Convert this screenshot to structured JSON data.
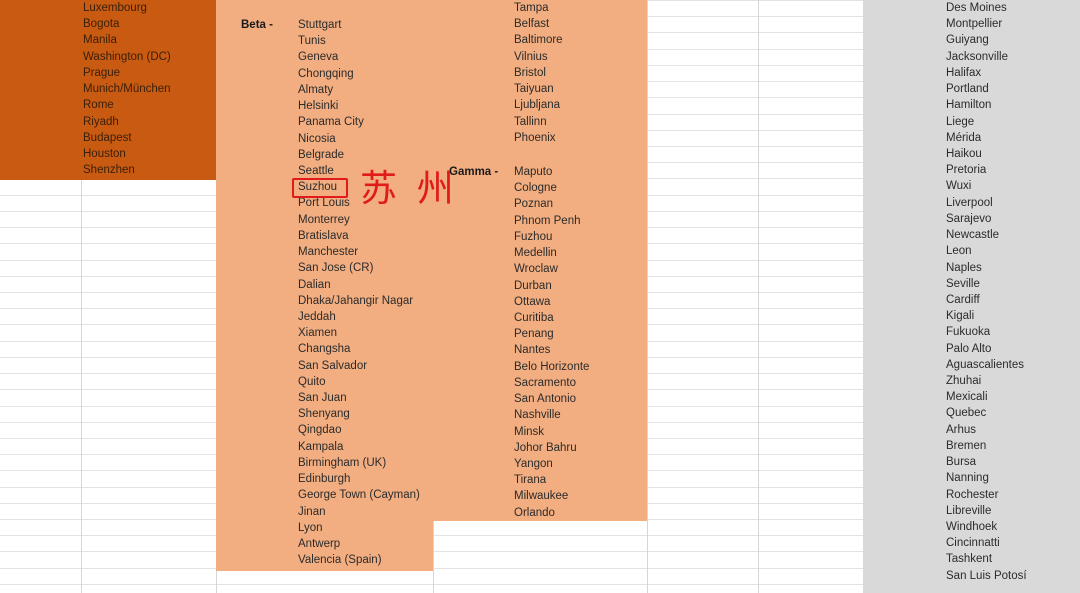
{
  "colors": {
    "alpha_block": "#c85a12",
    "beta_gamma_block": "#f2ae80",
    "right_block": "#d9d9d9",
    "annotation": "#e01b1b",
    "grid_line": "#e3e3e3"
  },
  "tier_labels": {
    "beta": "Beta -",
    "gamma": "Gamma -"
  },
  "annotation": {
    "highlighted_city": "Suzhou",
    "chinese_text": "苏 州"
  },
  "columns": {
    "alpha_tail": [
      "Luxembourg",
      "Bogota",
      "Manila",
      "Washington (DC)",
      "Prague",
      "Munich/München",
      "Rome",
      "Riyadh",
      "Budapest",
      "Houston",
      "Shenzhen"
    ],
    "beta": [
      "Stuttgart",
      "Tunis",
      "Geneva",
      "Chongqing",
      "Almaty",
      "Helsinki",
      "Panama City",
      "Nicosia",
      "Belgrade",
      "Seattle",
      "Suzhou",
      "Port Louis",
      "Monterrey",
      "Bratislava",
      "Manchester",
      "San Jose (CR)",
      "Dalian",
      "Dhaka/Jahangir Nagar",
      "Jeddah",
      "Xiamen",
      "Changsha",
      "San Salvador",
      "Quito",
      "San Juan",
      "Shenyang",
      "Qingdao",
      "Kampala",
      "Birmingham (UK)",
      "Edinburgh",
      "George Town (Cayman)",
      "Jinan",
      "Lyon",
      "Antwerp",
      "Valencia (Spain)"
    ],
    "beta_tail": [
      "Tampa",
      "Belfast",
      "Baltimore",
      "Vilnius",
      "Bristol",
      "Taiyuan",
      "Ljubljana",
      "Tallinn",
      "Phoenix"
    ],
    "gamma": [
      "Maputo",
      "Cologne",
      "Poznan",
      "Phnom Penh",
      "Fuzhou",
      "Medellin",
      "Wroclaw",
      "Durban",
      "Ottawa",
      "Curitiba",
      "Penang",
      "Nantes",
      "Belo Horizonte",
      "Sacramento",
      "San Antonio",
      "Nashville",
      "Minsk",
      "Johor Bahru",
      "Yangon",
      "Tirana",
      "Milwaukee",
      "Orlando"
    ],
    "right": [
      "Des Moines",
      "Montpellier",
      "Guiyang",
      "Jacksonville",
      "Halifax",
      "Portland",
      "Hamilton",
      "Liege",
      "Mérida",
      "Haikou",
      "Pretoria",
      "Wuxi",
      "Liverpool",
      "Sarajevo",
      "Newcastle",
      "Leon",
      "Naples",
      "Seville",
      "Cardiff",
      "Kigali",
      "Fukuoka",
      "Palo Alto",
      "Aguascalientes",
      "Zhuhai",
      "Mexicali",
      "Quebec",
      "Arhus",
      "Bremen",
      "Bursa",
      "Nanning",
      "Rochester",
      "Libreville",
      "Windhoek",
      "Cincinnatti",
      "Tashkent",
      "San Luis Potosí"
    ]
  }
}
